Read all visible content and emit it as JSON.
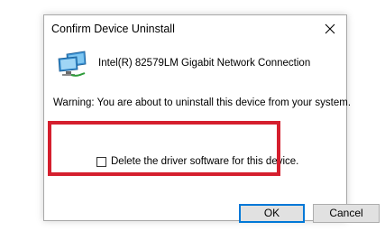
{
  "dialog": {
    "title": "Confirm Device Uninstall",
    "device_name": "Intel(R) 82579LM Gigabit Network Connection",
    "device_icon": "network-adapter-icon",
    "warning": "Warning: You are about to uninstall this device from your system.",
    "checkbox": {
      "label": "Delete the driver software for this device.",
      "checked": false
    },
    "buttons": {
      "ok": "OK",
      "cancel": "Cancel"
    }
  },
  "colors": {
    "highlight": "#d51f2e",
    "default_button_border": "#0078d7",
    "button_face": "#e1e1e1"
  }
}
